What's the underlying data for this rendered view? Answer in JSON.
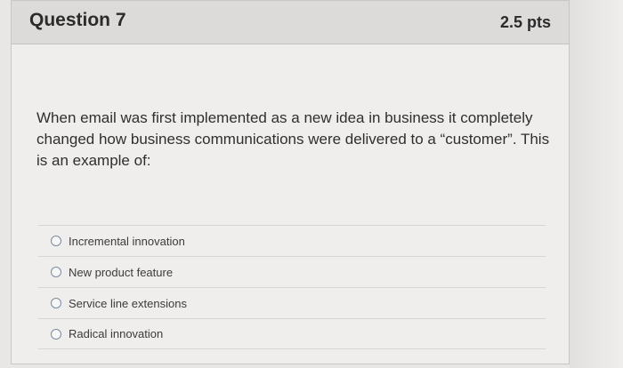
{
  "question": {
    "title": "Question 7",
    "points": "2.5 pts",
    "text": "When email was first implemented as a new idea in business it completely changed how business communications were delivered to a “customer”. This is an example of:"
  },
  "answers": [
    {
      "label": "Incremental innovation",
      "selected": false
    },
    {
      "label": "New product feature",
      "selected": false
    },
    {
      "label": "Service line extensions",
      "selected": false
    },
    {
      "label": "Radical innovation",
      "selected": false
    }
  ]
}
